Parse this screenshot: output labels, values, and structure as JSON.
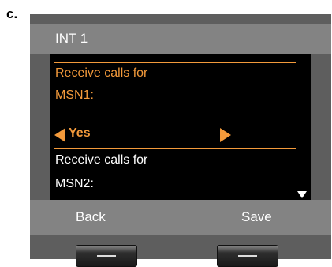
{
  "figure_label": "c.",
  "header": {
    "title": "INT 1"
  },
  "screen": {
    "option1_line1": "Receive calls for",
    "option1_line2": "MSN1:",
    "selected_value": "Yes",
    "option2_line1": "Receive calls for",
    "option2_line2": "MSN2:"
  },
  "softkeys": {
    "left_label": "Back",
    "right_label": "Save"
  },
  "icons": [
    "arrow-left-icon",
    "arrow-right-icon",
    "scroll-down-icon"
  ],
  "colors": {
    "accent": "#f39a3b",
    "screen_bg": "#000000",
    "bar_bg": "#838383",
    "device_bg": "#5e5e5e"
  }
}
